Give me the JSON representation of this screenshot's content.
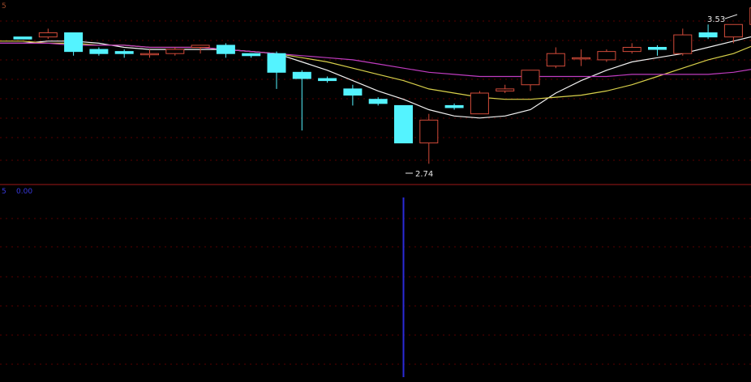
{
  "colors": {
    "background": "#000000",
    "up": "#d24b3a",
    "down": "#54f3ff",
    "grid": "#5a0000",
    "separator": "#a01818",
    "ma_white": "#f2f2f2",
    "ma_yellow": "#d8d04a",
    "ma_magenta": "#c03cc0",
    "indicator_bar": "#2a2ad8",
    "annotation": "#e6e6e6"
  },
  "header": {
    "top_label": "5",
    "lower_name": "5",
    "lower_value": "0.00"
  },
  "annotations": {
    "high_label": "3.53",
    "low_label": "2.74"
  },
  "chart_data": [
    {
      "type": "candlestick",
      "ylim": [
        2.68,
        3.56
      ],
      "candles": [
        {
          "o": 3.39,
          "h": 3.39,
          "l": 3.38,
          "c": 3.38
        },
        {
          "o": 3.39,
          "h": 3.43,
          "l": 3.38,
          "c": 3.41
        },
        {
          "o": 3.41,
          "h": 3.41,
          "l": 3.3,
          "c": 3.32
        },
        {
          "o": 3.33,
          "h": 3.34,
          "l": 3.3,
          "c": 3.31
        },
        {
          "o": 3.32,
          "h": 3.33,
          "l": 3.29,
          "c": 3.31
        },
        {
          "o": 3.31,
          "h": 3.33,
          "l": 3.29,
          "c": 3.31
        },
        {
          "o": 3.31,
          "h": 3.34,
          "l": 3.3,
          "c": 3.33
        },
        {
          "o": 3.34,
          "h": 3.35,
          "l": 3.31,
          "c": 3.35
        },
        {
          "o": 3.35,
          "h": 3.36,
          "l": 3.29,
          "c": 3.31
        },
        {
          "o": 3.31,
          "h": 3.31,
          "l": 3.29,
          "c": 3.3
        },
        {
          "o": 3.31,
          "h": 3.32,
          "l": 3.14,
          "c": 3.22
        },
        {
          "o": 3.22,
          "h": 3.23,
          "l": 2.94,
          "c": 3.19
        },
        {
          "o": 3.19,
          "h": 3.2,
          "l": 3.17,
          "c": 3.18
        },
        {
          "o": 3.14,
          "h": 3.16,
          "l": 3.06,
          "c": 3.11
        },
        {
          "o": 3.09,
          "h": 3.1,
          "l": 3.06,
          "c": 3.07
        },
        {
          "o": 3.06,
          "h": 3.06,
          "l": 2.88,
          "c": 2.88
        },
        {
          "o": 2.88,
          "h": 3.02,
          "l": 2.78,
          "c": 2.99
        },
        {
          "o": 3.06,
          "h": 3.07,
          "l": 3.04,
          "c": 3.05
        },
        {
          "o": 3.02,
          "h": 3.13,
          "l": 3.02,
          "c": 3.12
        },
        {
          "o": 3.13,
          "h": 3.16,
          "l": 3.12,
          "c": 3.14
        },
        {
          "o": 3.16,
          "h": 3.23,
          "l": 3.13,
          "c": 3.23
        },
        {
          "o": 3.25,
          "h": 3.34,
          "l": 3.24,
          "c": 3.31
        },
        {
          "o": 3.29,
          "h": 3.33,
          "l": 3.25,
          "c": 3.29
        },
        {
          "o": 3.28,
          "h": 3.33,
          "l": 3.27,
          "c": 3.32
        },
        {
          "o": 3.32,
          "h": 3.36,
          "l": 3.31,
          "c": 3.34
        },
        {
          "o": 3.34,
          "h": 3.35,
          "l": 3.3,
          "c": 3.33
        },
        {
          "o": 3.31,
          "h": 3.43,
          "l": 3.3,
          "c": 3.4
        },
        {
          "o": 3.41,
          "h": 3.45,
          "l": 3.38,
          "c": 3.39
        },
        {
          "o": 3.39,
          "h": 3.45,
          "l": 3.36,
          "c": 3.45
        },
        {
          "o": 3.45,
          "h": 3.53,
          "l": 3.4,
          "c": 3.53
        }
      ],
      "moving_averages": [
        {
          "color_key": "ma_white",
          "values": [
            3.36,
            3.37,
            3.37,
            3.36,
            3.34,
            3.33,
            3.33,
            3.33,
            3.33,
            3.32,
            3.31,
            3.27,
            3.23,
            3.18,
            3.13,
            3.09,
            3.04,
            3.01,
            3.0,
            3.01,
            3.04,
            3.12,
            3.18,
            3.23,
            3.27,
            3.29,
            3.31,
            3.34,
            3.37,
            3.4
          ]
        },
        {
          "color_key": "ma_yellow",
          "values": [
            3.37,
            3.36,
            3.36,
            3.35,
            3.35,
            3.34,
            3.34,
            3.34,
            3.33,
            3.32,
            3.31,
            3.29,
            3.27,
            3.24,
            3.21,
            3.18,
            3.14,
            3.12,
            3.1,
            3.09,
            3.09,
            3.1,
            3.11,
            3.13,
            3.16,
            3.2,
            3.24,
            3.28,
            3.31,
            3.36
          ]
        },
        {
          "color_key": "ma_magenta",
          "values": [
            3.36,
            3.36,
            3.35,
            3.35,
            3.35,
            3.34,
            3.34,
            3.34,
            3.33,
            3.32,
            3.31,
            3.3,
            3.29,
            3.28,
            3.26,
            3.24,
            3.22,
            3.21,
            3.2,
            3.2,
            3.2,
            3.2,
            3.2,
            3.2,
            3.21,
            3.21,
            3.21,
            3.21,
            3.22,
            3.24
          ]
        }
      ]
    },
    {
      "type": "indicator",
      "bars": [
        {
          "index": 15,
          "value": 1
        }
      ]
    }
  ]
}
